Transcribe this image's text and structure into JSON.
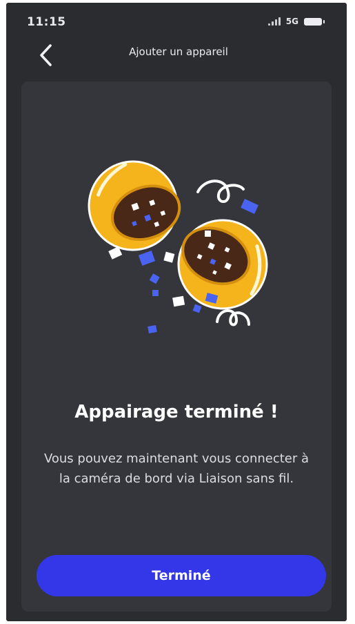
{
  "status_bar": {
    "time": "11:15",
    "network": "5G",
    "icons": [
      "signal-icon",
      "battery-icon"
    ]
  },
  "nav": {
    "title": "Ajouter un appareil",
    "back_icon": "chevron-left-icon"
  },
  "content": {
    "illustration": "confetti-capsule-illustration",
    "headline": "Appairage terminé !",
    "description": "Vous pouvez maintenant vous connecter à la caméra de bord via Liaison sans fil."
  },
  "actions": {
    "done_label": "Terminé"
  },
  "colors": {
    "background": "#2b2c30",
    "card": "#35363c",
    "accent": "#3437e8",
    "capsule": "#f5b41c",
    "confetti_blue": "#4a63f0"
  }
}
